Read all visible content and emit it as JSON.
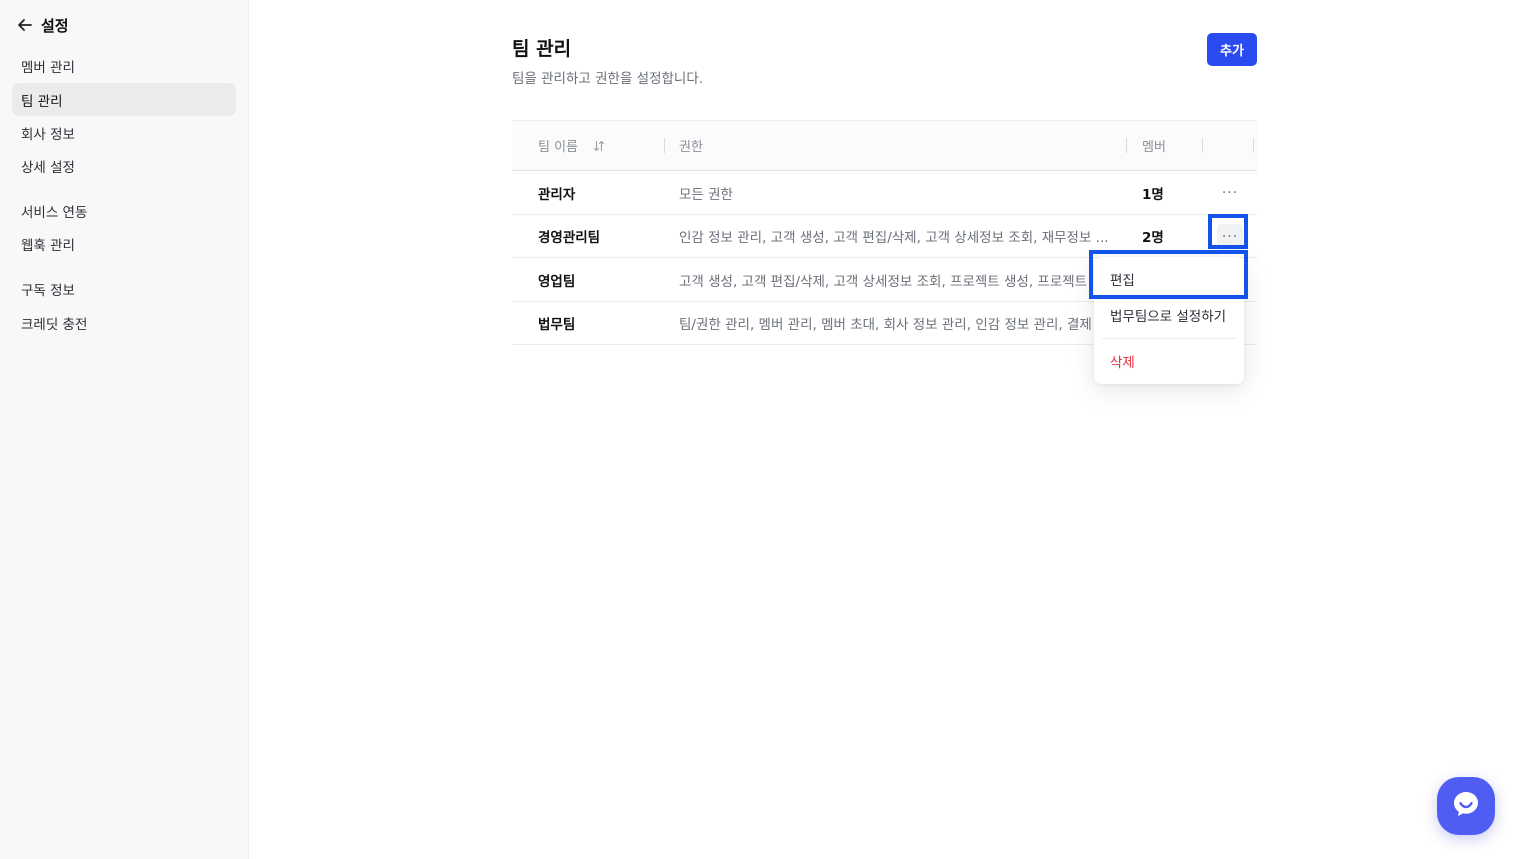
{
  "sidebar": {
    "title": "설정",
    "items": [
      {
        "label": "멤버 관리"
      },
      {
        "label": "팀 관리"
      },
      {
        "label": "회사 정보"
      },
      {
        "label": "상세 설정"
      },
      {
        "label": "서비스 연동"
      },
      {
        "label": "웹훅 관리"
      },
      {
        "label": "구독 정보"
      },
      {
        "label": "크레딧 충전"
      }
    ],
    "active_item": "팀 관리"
  },
  "main": {
    "title": "팀 관리",
    "description": "팀을 관리하고 권한을 설정합니다.",
    "add_button": "추가"
  },
  "table": {
    "columns": [
      "팀 이름",
      "권한",
      "멤버"
    ],
    "rows": [
      {
        "name": "관리자",
        "permissions": "모든 권한",
        "members": "1명",
        "more": "···"
      },
      {
        "name": "경영관리팀",
        "permissions": "인감 정보 관리, 고객 생성, 고객 편집/삭제, 고객 상세정보 조회, 재무정보 ...",
        "members": "2명",
        "more": "···"
      },
      {
        "name": "영업팀",
        "permissions": "고객 생성, 고객 편집/삭제, 고객 상세정보 조회, 프로젝트 생성, 프로젝트",
        "members": "",
        "more": ""
      },
      {
        "name": "법무팀",
        "permissions": "팀/권한 관리, 멤버 관리, 멤버 초대, 회사 정보 관리, 인감 정보 관리, 결제",
        "members": "",
        "more": ""
      }
    ]
  },
  "dropdown": {
    "items": [
      {
        "label": "편집"
      },
      {
        "label": "법무팀으로 설정하기"
      },
      {
        "label": "삭제"
      }
    ]
  },
  "colors": {
    "accent": "#2a4bf0",
    "highlight": "#1254ec",
    "danger": "#e0323e",
    "chat": "#4f5df2"
  },
  "icons": {
    "back": "arrow-left-icon",
    "sort": "sort-icon",
    "chat": "chat-icon"
  }
}
